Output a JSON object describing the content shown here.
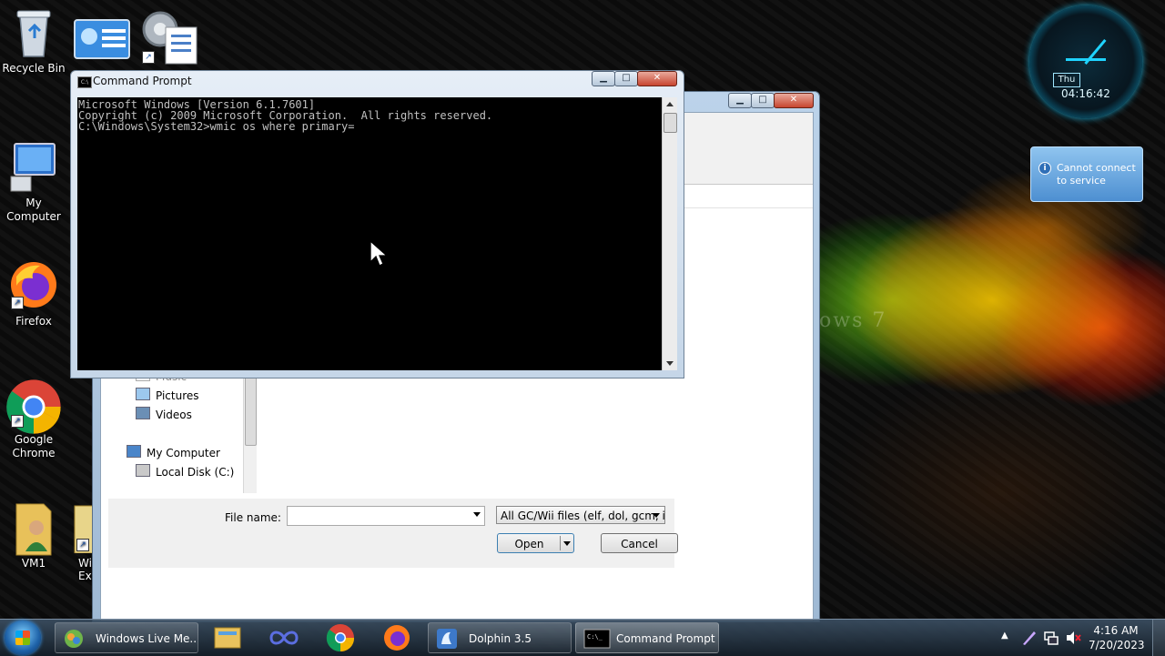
{
  "desktop": {
    "icons": [
      {
        "label": "Recycle Bin"
      },
      {
        "label": "My Computer"
      },
      {
        "label": "Firefox"
      },
      {
        "label": "Google Chrome"
      },
      {
        "label": "VM1"
      },
      {
        "label": "Win Exp"
      }
    ],
    "watermark": "ows 7"
  },
  "gadgets": {
    "clock": {
      "day": "Thu",
      "time": "04:16:42"
    },
    "weather": {
      "message": "Cannot connect to service"
    }
  },
  "file_dialog": {
    "nav_items": [
      {
        "label": "Music"
      },
      {
        "label": "Pictures"
      },
      {
        "label": "Videos"
      },
      {
        "label": "My Computer"
      },
      {
        "label": "Local Disk (C:)"
      }
    ],
    "file_name_label": "File name:",
    "file_name_value": "",
    "file_type": "All GC/Wii files (elf, dol, gcm, is",
    "open_label": "Open",
    "cancel_label": "Cancel"
  },
  "cmd": {
    "title": "Command Prompt",
    "lines": [
      "Microsoft Windows [Version 6.1.7601]",
      "Copyright (c) 2009 Microsoft Corporation.  All rights reserved.",
      "",
      "C:\\Windows\\System32>wmic os where primary="
    ]
  },
  "taskbar": {
    "tasks": [
      {
        "label": "Windows Live Me..."
      },
      {
        "label": "Dolphin 3.5"
      },
      {
        "label": "Command Prompt"
      }
    ],
    "time": "4:16 AM",
    "date": "7/20/2023"
  },
  "colors": {
    "console_bg": "#000000",
    "console_text": "#c0c0c0",
    "close_button": "#c7452f"
  }
}
